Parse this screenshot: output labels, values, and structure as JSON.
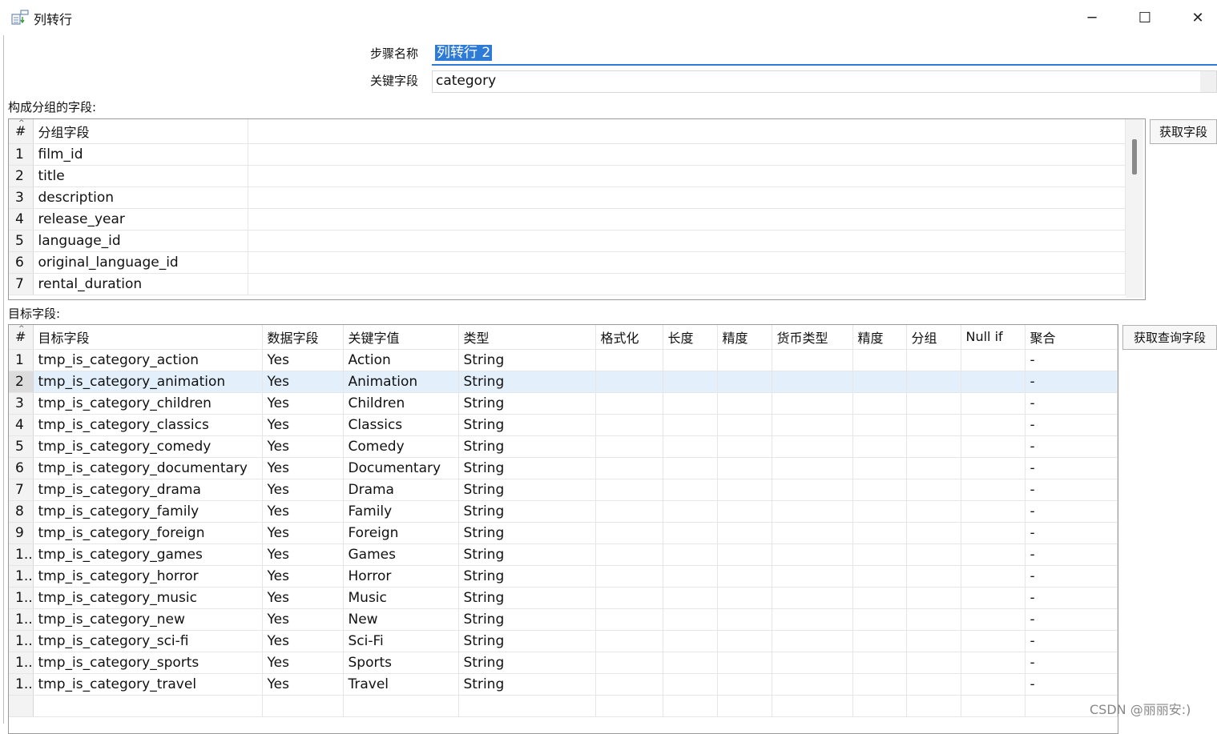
{
  "window": {
    "title": "列转行",
    "minimize_glyph": "─",
    "maximize_glyph": "☐",
    "close_glyph": "✕"
  },
  "form": {
    "step_name_label": "步骤名称",
    "step_name_value": "列转行 2",
    "key_field_label": "关键字段",
    "key_field_value": "category"
  },
  "group_section": {
    "label": "构成分组的字段:",
    "columns": [
      "#",
      "分组字段"
    ],
    "rows": [
      {
        "n": "1",
        "field": "film_id"
      },
      {
        "n": "2",
        "field": "title"
      },
      {
        "n": "3",
        "field": "description"
      },
      {
        "n": "4",
        "field": "release_year"
      },
      {
        "n": "5",
        "field": "language_id"
      },
      {
        "n": "6",
        "field": "original_language_id"
      },
      {
        "n": "7",
        "field": "rental_duration"
      }
    ],
    "get_fields_button": "获取字段"
  },
  "target_section": {
    "label": "目标字段:",
    "columns": [
      "#",
      "目标字段",
      "数据字段",
      "关键字值",
      "类型",
      "格式化",
      "长度",
      "精度",
      "货币类型",
      "精度",
      "分组",
      "Null if",
      "聚合"
    ],
    "rows": [
      {
        "n": "1",
        "target": "tmp_is_category_action",
        "data": "Yes",
        "key": "Action",
        "type": "String",
        "agg": "-"
      },
      {
        "n": "2",
        "target": "tmp_is_category_animation",
        "data": "Yes",
        "key": "Animation",
        "type": "String",
        "agg": "-"
      },
      {
        "n": "3",
        "target": "tmp_is_category_children",
        "data": "Yes",
        "key": "Children",
        "type": "String",
        "agg": "-"
      },
      {
        "n": "4",
        "target": "tmp_is_category_classics",
        "data": "Yes",
        "key": "Classics",
        "type": "String",
        "agg": "-"
      },
      {
        "n": "5",
        "target": "tmp_is_category_comedy",
        "data": "Yes",
        "key": "Comedy",
        "type": "String",
        "agg": "-"
      },
      {
        "n": "6",
        "target": "tmp_is_category_documentary",
        "data": "Yes",
        "key": "Documentary",
        "type": "String",
        "agg": "-"
      },
      {
        "n": "7",
        "target": "tmp_is_category_drama",
        "data": "Yes",
        "key": "Drama",
        "type": "String",
        "agg": "-"
      },
      {
        "n": "8",
        "target": "tmp_is_category_family",
        "data": "Yes",
        "key": "Family",
        "type": "String",
        "agg": "-"
      },
      {
        "n": "9",
        "target": "tmp_is_category_foreign",
        "data": "Yes",
        "key": "Foreign",
        "type": "String",
        "agg": "-"
      },
      {
        "n": "1..",
        "target": "tmp_is_category_games",
        "data": "Yes",
        "key": "Games",
        "type": "String",
        "agg": "-"
      },
      {
        "n": "1..",
        "target": "tmp_is_category_horror",
        "data": "Yes",
        "key": "Horror",
        "type": "String",
        "agg": "-"
      },
      {
        "n": "1..",
        "target": "tmp_is_category_music",
        "data": "Yes",
        "key": "Music",
        "type": "String",
        "agg": "-"
      },
      {
        "n": "1..",
        "target": "tmp_is_category_new",
        "data": "Yes",
        "key": "New",
        "type": "String",
        "agg": "-"
      },
      {
        "n": "1..",
        "target": "tmp_is_category_sci-fi",
        "data": "Yes",
        "key": "Sci-Fi",
        "type": "String",
        "agg": "-"
      },
      {
        "n": "1..",
        "target": "tmp_is_category_sports",
        "data": "Yes",
        "key": "Sports",
        "type": "String",
        "agg": "-"
      },
      {
        "n": "1..",
        "target": "tmp_is_category_travel",
        "data": "Yes",
        "key": "Travel",
        "type": "String",
        "agg": "-"
      }
    ],
    "selected_row": 2,
    "get_lookup_fields_button": "获取查询字段"
  },
  "watermark": "CSDN @丽丽安:)"
}
